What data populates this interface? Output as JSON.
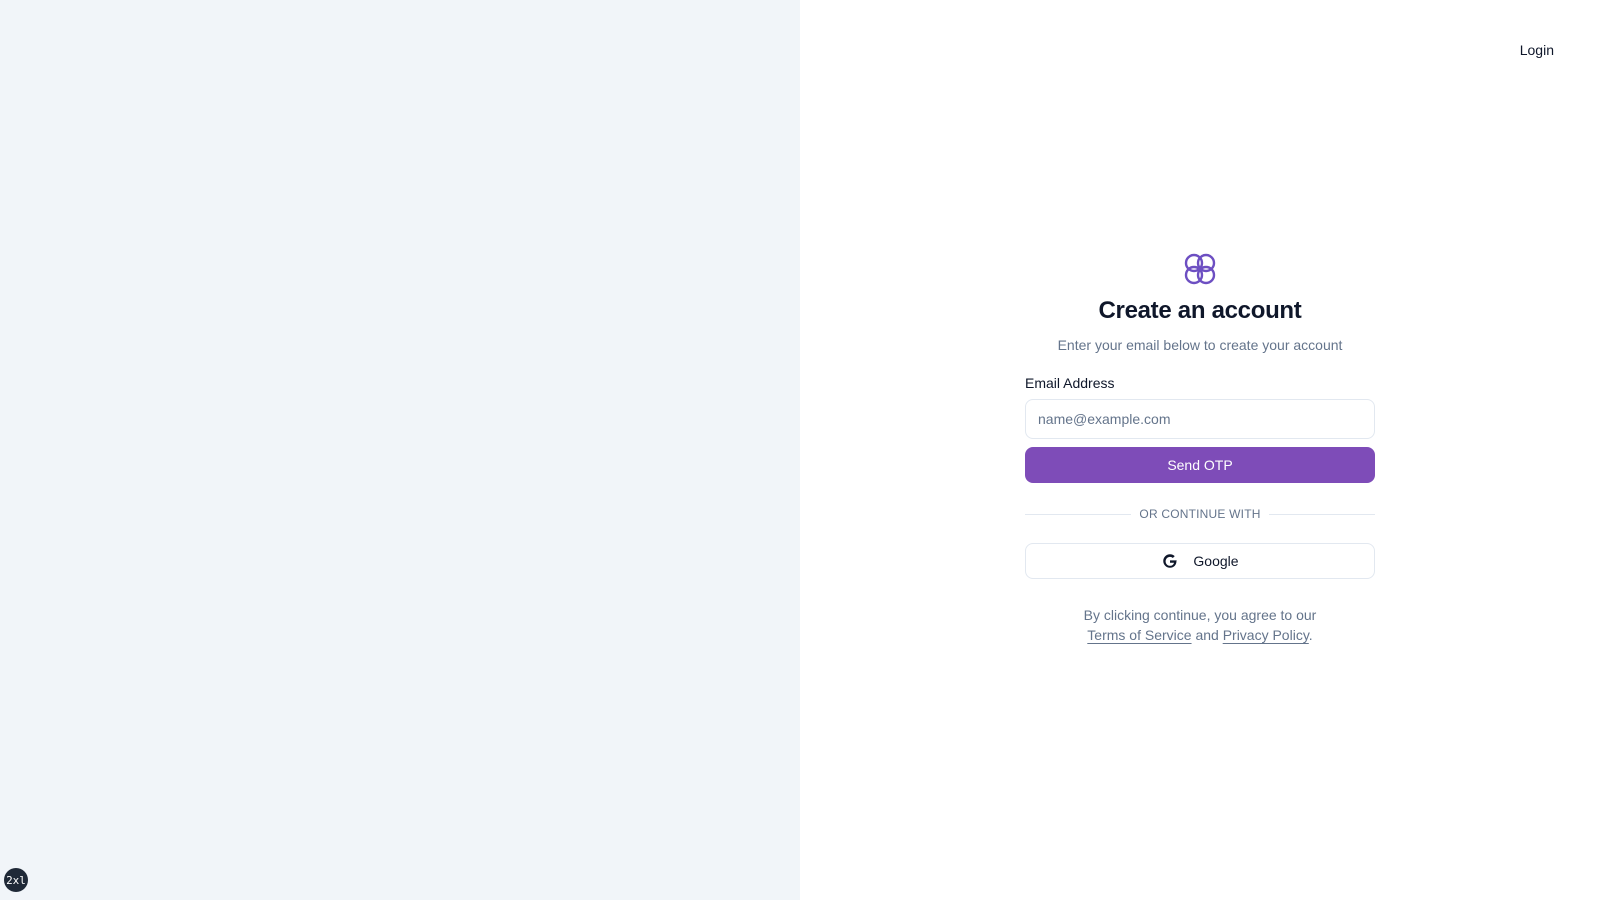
{
  "header": {
    "login_label": "Login"
  },
  "badge": {
    "breakpoint": "2xl"
  },
  "form": {
    "logo_icon": "four-petal-logo-icon",
    "title": "Create an account",
    "subtitle": "Enter your email below to create your account",
    "email_label": "Email Address",
    "email_placeholder": "name@example.com",
    "email_value": "",
    "submit_label": "Send OTP",
    "divider_text": "OR CONTINUE WITH",
    "google_label": "Google",
    "google_icon": "google-icon"
  },
  "terms": {
    "prefix": "By clicking continue, you agree to our",
    "terms_link": "Terms of Service",
    "connector": "and",
    "privacy_link": "Privacy Policy",
    "suffix": "."
  },
  "colors": {
    "accent": "#7e4cb8",
    "logo": "#6d4fc2",
    "left_panel_bg": "#f1f5f9",
    "muted_text": "#64748b",
    "border": "#e2e8f0"
  }
}
